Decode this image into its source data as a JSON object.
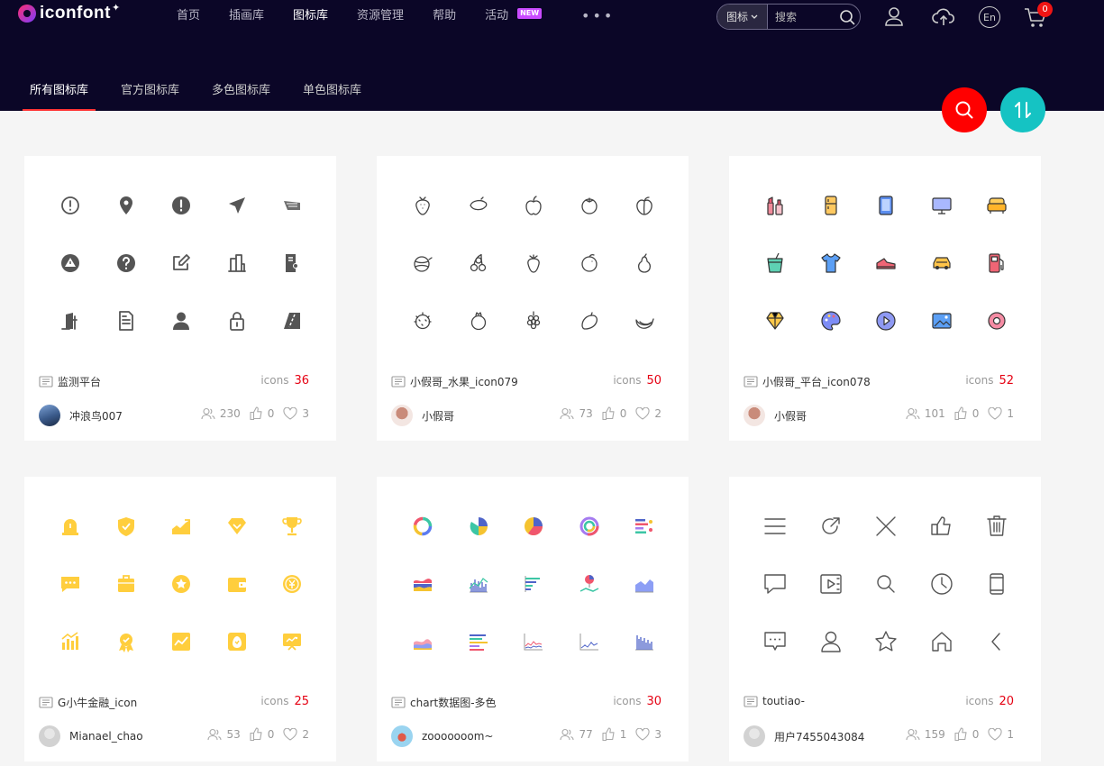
{
  "brand": {
    "name": "iconfont"
  },
  "nav": {
    "items": [
      {
        "label": "首页",
        "active": false
      },
      {
        "label": "插画库",
        "active": false
      },
      {
        "label": "图标库",
        "active": true
      },
      {
        "label": "资源管理",
        "active": false
      },
      {
        "label": "帮助",
        "active": false
      },
      {
        "label": "活动",
        "active": false,
        "badge": "NEW"
      }
    ],
    "more": "•••"
  },
  "search": {
    "scope": "图标",
    "placeholder": "搜索"
  },
  "cart": {
    "count": "0"
  },
  "language": "En",
  "tabs": [
    {
      "label": "所有图标库",
      "active": true
    },
    {
      "label": "官方图标库",
      "active": false
    },
    {
      "label": "多色图标库",
      "active": false
    },
    {
      "label": "单色图标库",
      "active": false
    }
  ],
  "icons_label": "icons",
  "cards": [
    {
      "title": "监测平台",
      "count": "36",
      "author": "冲浪鸟007",
      "views": "230",
      "likes": "0",
      "favorites": "3",
      "style": "mono-dark",
      "color": "#555555",
      "icons": [
        "exclamation-circle-outline",
        "location-pin",
        "exclamation-circle",
        "send-arrow",
        "radar",
        "warning-circle",
        "question-circle",
        "edit",
        "buildings",
        "document-person",
        "door-exit",
        "document",
        "user",
        "lock",
        "road"
      ]
    },
    {
      "title": "小假哥_水果_icon079",
      "count": "50",
      "author": "小假哥",
      "views": "73",
      "likes": "0",
      "favorites": "2",
      "style": "outline",
      "color": "#444444",
      "icons": [
        "strawberry",
        "lemon",
        "apple",
        "tomato",
        "peach",
        "watermelon",
        "cherry",
        "strawberry-outline",
        "orange",
        "pear",
        "durian",
        "pomegranate",
        "grapes",
        "mango",
        "banana"
      ]
    },
    {
      "title": "小假哥_平台_icon078",
      "count": "52",
      "author": "小假哥",
      "views": "101",
      "likes": "0",
      "favorites": "1",
      "style": "multicolor",
      "icons": [
        "cosmetics",
        "refrigerator",
        "tablet",
        "monitor",
        "sofa",
        "drink",
        "t-shirt",
        "shoe",
        "car",
        "fuel",
        "diamond",
        "palette",
        "play",
        "picture",
        "flower"
      ]
    },
    {
      "title": "G小牛金融_icon",
      "count": "25",
      "author": "Mianael_chao",
      "views": "53",
      "likes": "0",
      "favorites": "2",
      "style": "yellow",
      "color": "#ffce3d",
      "icons": [
        "alarm",
        "shield",
        "trend-chart",
        "diamond",
        "trophy",
        "message",
        "briefcase",
        "star-medal",
        "wallet",
        "coin",
        "bar-chart",
        "badge",
        "line-chart",
        "egg",
        "presentation"
      ]
    },
    {
      "title": "chart数据图-多色",
      "count": "30",
      "author": "zooooooom~",
      "views": "77",
      "likes": "1",
      "favorites": "3",
      "style": "charts",
      "icons": [
        "donut-chart",
        "pie-chart",
        "pie-chart-2",
        "donut-chart-2",
        "bar-list",
        "stream-chart",
        "column-chart",
        "horizontal-bar",
        "map-chart",
        "area-chart",
        "stacked-area",
        "bar-chart-lines",
        "line-chart",
        "line-chart-2",
        "column-chart-2"
      ]
    },
    {
      "title": "toutiao-",
      "count": "20",
      "author": "用户7455043084",
      "views": "159",
      "likes": "0",
      "favorites": "1",
      "style": "thin",
      "color": "#555555",
      "icons": [
        "menu",
        "share",
        "close",
        "thumbs-up",
        "trash",
        "comment",
        "video",
        "search",
        "clock",
        "phone",
        "message-dots",
        "user",
        "star",
        "home",
        "chevron-left"
      ]
    }
  ]
}
